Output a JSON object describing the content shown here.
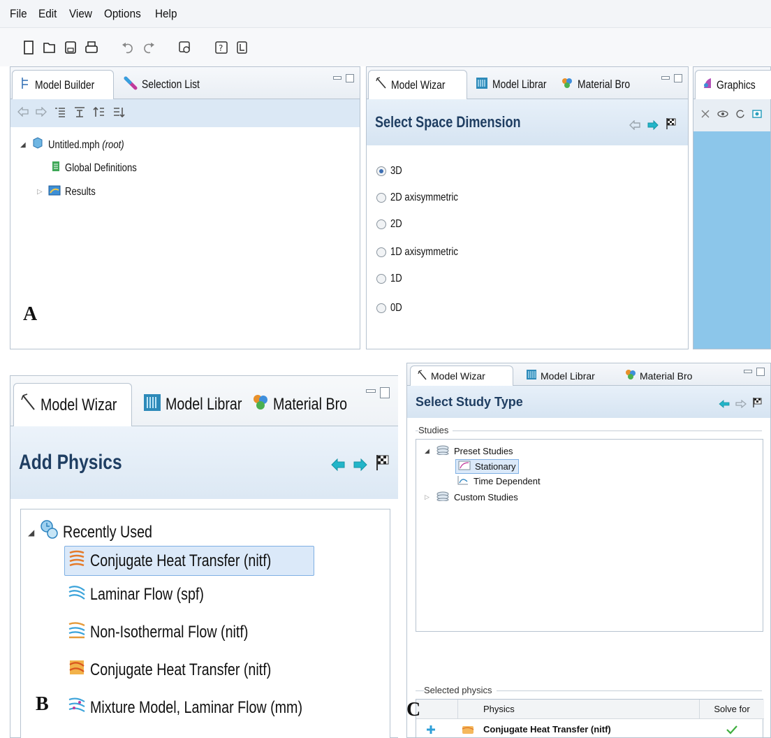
{
  "menubar": {
    "items": [
      "File",
      "Edit",
      "View",
      "Options",
      "Help"
    ]
  },
  "toolbar": {
    "icons": [
      "new-file-icon",
      "open-icon",
      "save-icon",
      "print-icon",
      "undo-icon",
      "redo-icon",
      "update-icon",
      "help-icon",
      "documentation-icon"
    ]
  },
  "panel_a": {
    "tabs": {
      "model_builder": "Model Builder",
      "selection_list": "Selection List"
    },
    "tree": {
      "root": "Untitled.mph",
      "root_suffix": "(root)",
      "global": "Global Definitions",
      "results": "Results"
    },
    "wizard_tabs": {
      "model_wizard": "Model Wizar",
      "model_library": "Model Librar",
      "material_browser": "Material Bro"
    },
    "wizard_title": "Select Space Dimension",
    "dimensions": [
      {
        "label": "3D",
        "selected": true
      },
      {
        "label": "2D axisymmetric",
        "selected": false
      },
      {
        "label": "2D",
        "selected": false
      },
      {
        "label": "1D axisymmetric",
        "selected": false
      },
      {
        "label": "1D",
        "selected": false
      },
      {
        "label": "0D",
        "selected": false
      }
    ],
    "graphics_tab": "Graphics",
    "letter": "A"
  },
  "panel_b": {
    "tabs": {
      "model_wizard": "Model Wizar",
      "model_library": "Model Librar",
      "material_browser": "Material Bro"
    },
    "title": "Add Physics",
    "group": "Recently Used",
    "items": [
      "Conjugate Heat Transfer (nitf)",
      "Laminar Flow (spf)",
      "Non-Isothermal Flow (nitf)",
      "Conjugate Heat Transfer (nitf)",
      "Mixture Model, Laminar Flow (mm)"
    ],
    "letter": "B"
  },
  "panel_c": {
    "tabs": {
      "model_wizard": "Model Wizar",
      "model_library": "Model Librar",
      "material_browser": "Material Bro"
    },
    "title": "Select Study Type",
    "studies_label": "Studies",
    "preset": "Preset Studies",
    "stationary": "Stationary",
    "time_dependent": "Time Dependent",
    "custom": "Custom Studies",
    "selected_physics_label": "Selected physics",
    "columns": {
      "physics": "Physics",
      "solve_for": "Solve for"
    },
    "row": {
      "physics": "Conjugate Heat Transfer (nitf)"
    },
    "letter": "C"
  },
  "colors": {
    "header_text": "#1f3e62",
    "nav_arrow": "#22b5c9",
    "graphics_bg": "#8cc6ea",
    "selection": "#dbe9f9"
  }
}
